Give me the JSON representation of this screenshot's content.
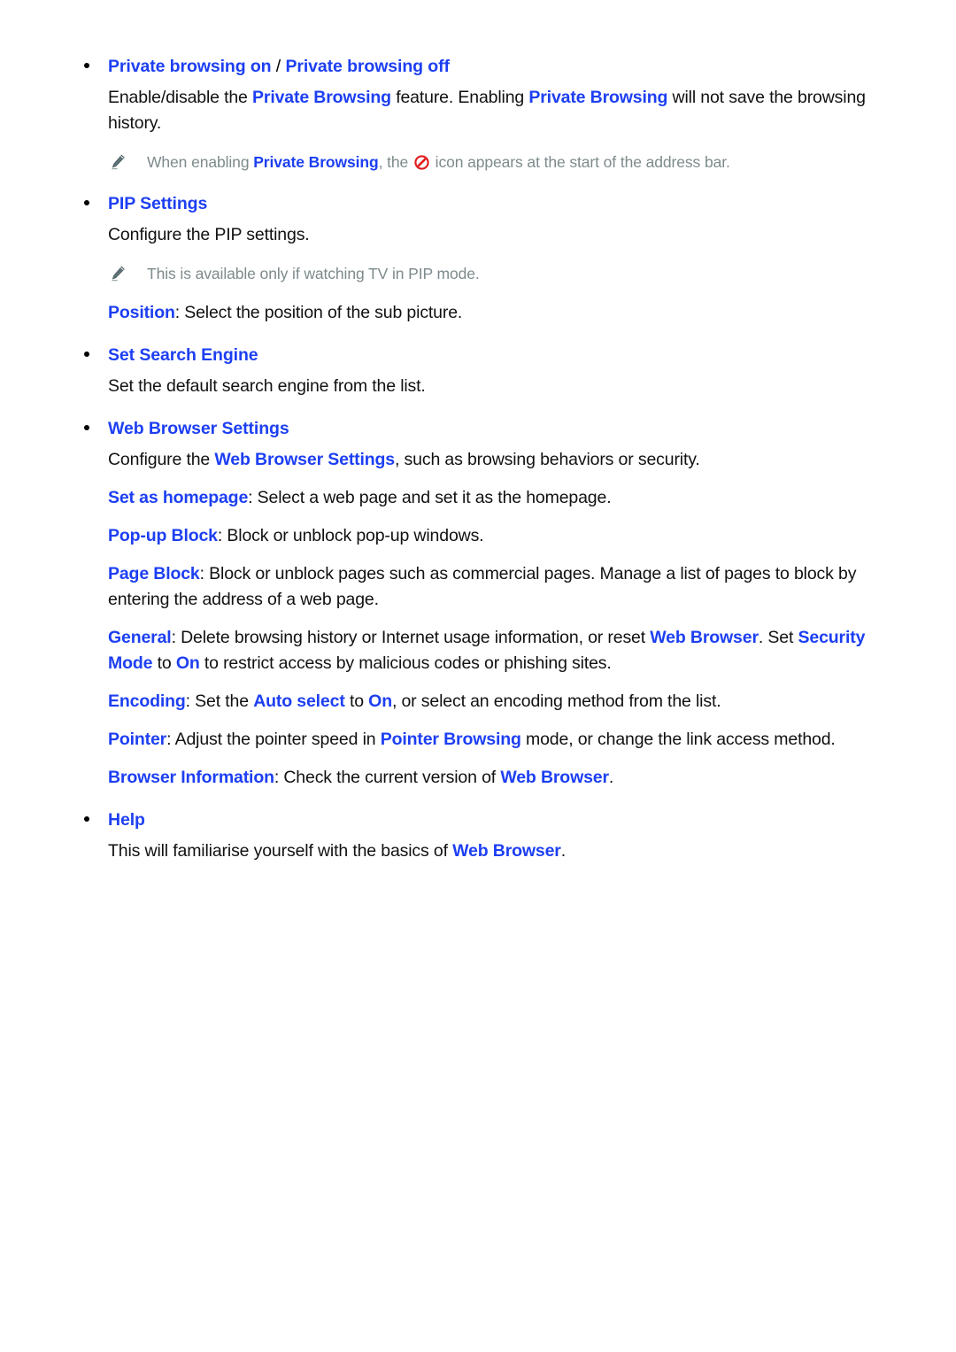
{
  "document": {
    "background_color": "#ffffff",
    "link_color": "#1d3ff2",
    "body_color": "#111111",
    "note_color": "#7d8a8c",
    "icon_color": "#e01b1b"
  },
  "sections": [
    {
      "id": "private-browsing",
      "heading_a": "Private browsing on",
      "heading_sep": " / ",
      "heading_b": "Private browsing off",
      "body": {
        "p1": "Enable/disable the ",
        "t1": "Private Browsing",
        "p2": " feature. Enabling ",
        "t2": "Private Browsing",
        "p3": " will not save the browsing history."
      },
      "note": {
        "icon": "pencil-icon",
        "n1": "When enabling ",
        "t1": "Private Browsing",
        "n2": ", the ",
        "inline_icon": "prohibition-icon",
        "n3": " icon appears at the start of the address bar."
      }
    },
    {
      "id": "pip-settings",
      "heading": "PIP Settings",
      "body": "Configure the PIP settings.",
      "note": {
        "icon": "pencil-icon",
        "text": "This is available only if watching TV in PIP mode."
      },
      "option": {
        "term": "Position",
        "text": ": Select the position of the sub picture."
      }
    },
    {
      "id": "set-search-engine",
      "heading": "Set Search Engine",
      "body": "Set the default search engine from the list."
    },
    {
      "id": "web-browser-settings",
      "heading": "Web Browser Settings",
      "intro": {
        "p1": "Configure the ",
        "t1": "Web Browser Settings",
        "p2": ", such as browsing behaviors or security."
      },
      "options": [
        {
          "term": "Set as homepage",
          "text": ": Select a web page and set it as the homepage."
        },
        {
          "term": "Pop-up Block",
          "text": ": Block or unblock pop-up windows."
        },
        {
          "term": "Page Block",
          "text": ": Block or unblock pages such as commercial pages. Manage a list of pages to block by entering the address of a web page."
        }
      ],
      "general": {
        "term": "General",
        "p1": ": Delete browsing history or Internet usage information, or reset ",
        "t1": "Web Browser",
        "p2": ". Set ",
        "t2": "Security Mode",
        "p3": " to ",
        "t3": "On",
        "p4": " to restrict access by malicious codes or phishing sites."
      },
      "encoding": {
        "term": "Encoding",
        "p1": ": Set the ",
        "t1": "Auto select",
        "p2": " to ",
        "t2": "On",
        "p3": ", or select an encoding method from the list."
      },
      "pointer": {
        "term": "Pointer",
        "p1": ": Adjust the pointer speed in ",
        "t1": "Pointer Browsing",
        "p2": " mode, or change the link access method."
      },
      "browser_information": {
        "term": "Browser Information",
        "p1": ": Check the current version of ",
        "t1": "Web Browser",
        "p2": "."
      }
    },
    {
      "id": "help",
      "heading": "Help",
      "body": {
        "p1": "This will familiarise yourself with the basics of ",
        "t1": "Web Browser",
        "p2": "."
      }
    }
  ]
}
